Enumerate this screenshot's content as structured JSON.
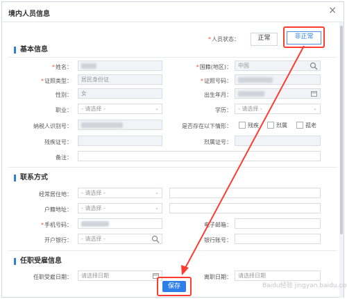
{
  "window": {
    "title": "境内人员信息",
    "close_label": "×"
  },
  "status": {
    "label": "人员状态：",
    "options": [
      "正常",
      "非正常"
    ],
    "selected": "非正常"
  },
  "sections": {
    "basic": "基本信息",
    "contact": "联系方式",
    "employment": "任职受雇信息"
  },
  "basic": {
    "name_label": "姓名：",
    "nationality_label": "国籍(地区)：",
    "nationality_value": "中国",
    "id_type_label": "证照类型：",
    "id_type_value": "居民身份证",
    "id_no_label": "证照号码：",
    "gender_label": "性别：",
    "gender_value": "女",
    "birth_label": "出生年月：",
    "occupation_label": "职业：",
    "occupation_placeholder": "- 请选择 -",
    "education_label": "学历：",
    "education_placeholder": "- 请选择 -",
    "taxpayer_id_label": "纳税人识别号：",
    "situation_label": "是否存在以下情形：",
    "situations": [
      "残疾",
      "烈属",
      "孤老"
    ],
    "disability_no_label": "残疾证号：",
    "martyr_no_label": "烈属证号：",
    "remark_label": "备注："
  },
  "contact": {
    "residence_label": "经常居住地：",
    "residence_placeholder": "- 请选择 -",
    "household_label": "户籍地址：",
    "household_placeholder": "- 请选择 -",
    "mobile_label": "手机号码：",
    "email_label": "电子邮箱：",
    "bank_label": "开户银行：",
    "bank_placeholder": "- 请选择 -",
    "account_label": "银行账号："
  },
  "employment": {
    "hire_date_label": "任职受雇日期：",
    "hire_date_placeholder": "请选择日期",
    "leave_date_label": "离职日期：",
    "leave_date_placeholder": "请选择日期"
  },
  "footer": {
    "save_label": "保存"
  },
  "watermark": "Baidu经验  jingyan.baidu.com",
  "colors": {
    "accent": "#2f7fe8",
    "annotation": "#ff3b30",
    "required": "#e84b3c"
  }
}
